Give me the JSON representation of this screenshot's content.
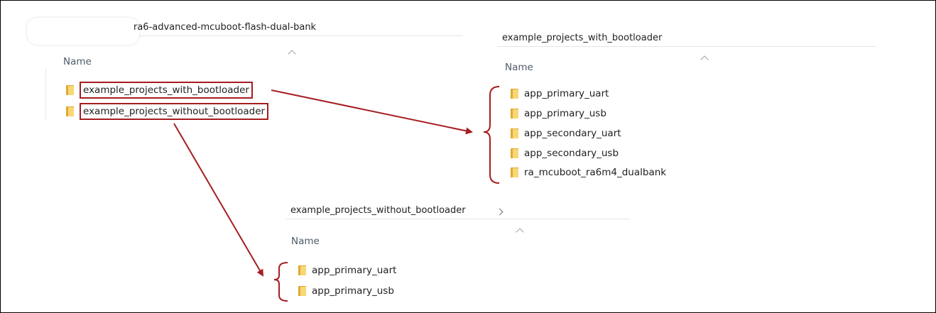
{
  "panels": {
    "root": {
      "path": "ra6-advanced-mcuboot-flash-dual-bank",
      "header": "Name",
      "items": [
        {
          "label": "example_projects_with_bootloader",
          "icon": "folder-icon"
        },
        {
          "label": "example_projects_without_bootloader",
          "icon": "folder-icon"
        }
      ]
    },
    "with_bootloader": {
      "path": "example_projects_with_bootloader",
      "header": "Name",
      "items": [
        {
          "label": "app_primary_uart",
          "icon": "folder-icon"
        },
        {
          "label": "app_primary_usb",
          "icon": "folder-icon"
        },
        {
          "label": "app_secondary_uart",
          "icon": "folder-icon"
        },
        {
          "label": "app_secondary_usb",
          "icon": "folder-icon"
        },
        {
          "label": "ra_mcuboot_ra6m4_dualbank",
          "icon": "folder-icon"
        }
      ]
    },
    "without_bootloader": {
      "path": "example_projects_without_bootloader",
      "header": "Name",
      "items": [
        {
          "label": "app_primary_uart",
          "icon": "folder-icon"
        },
        {
          "label": "app_primary_usb",
          "icon": "folder-icon"
        }
      ]
    }
  },
  "colors": {
    "highlight": "#a51d22",
    "folder_dark": "#e0a932",
    "folder_light": "#f8d775",
    "header_text": "#4d5a6a"
  }
}
